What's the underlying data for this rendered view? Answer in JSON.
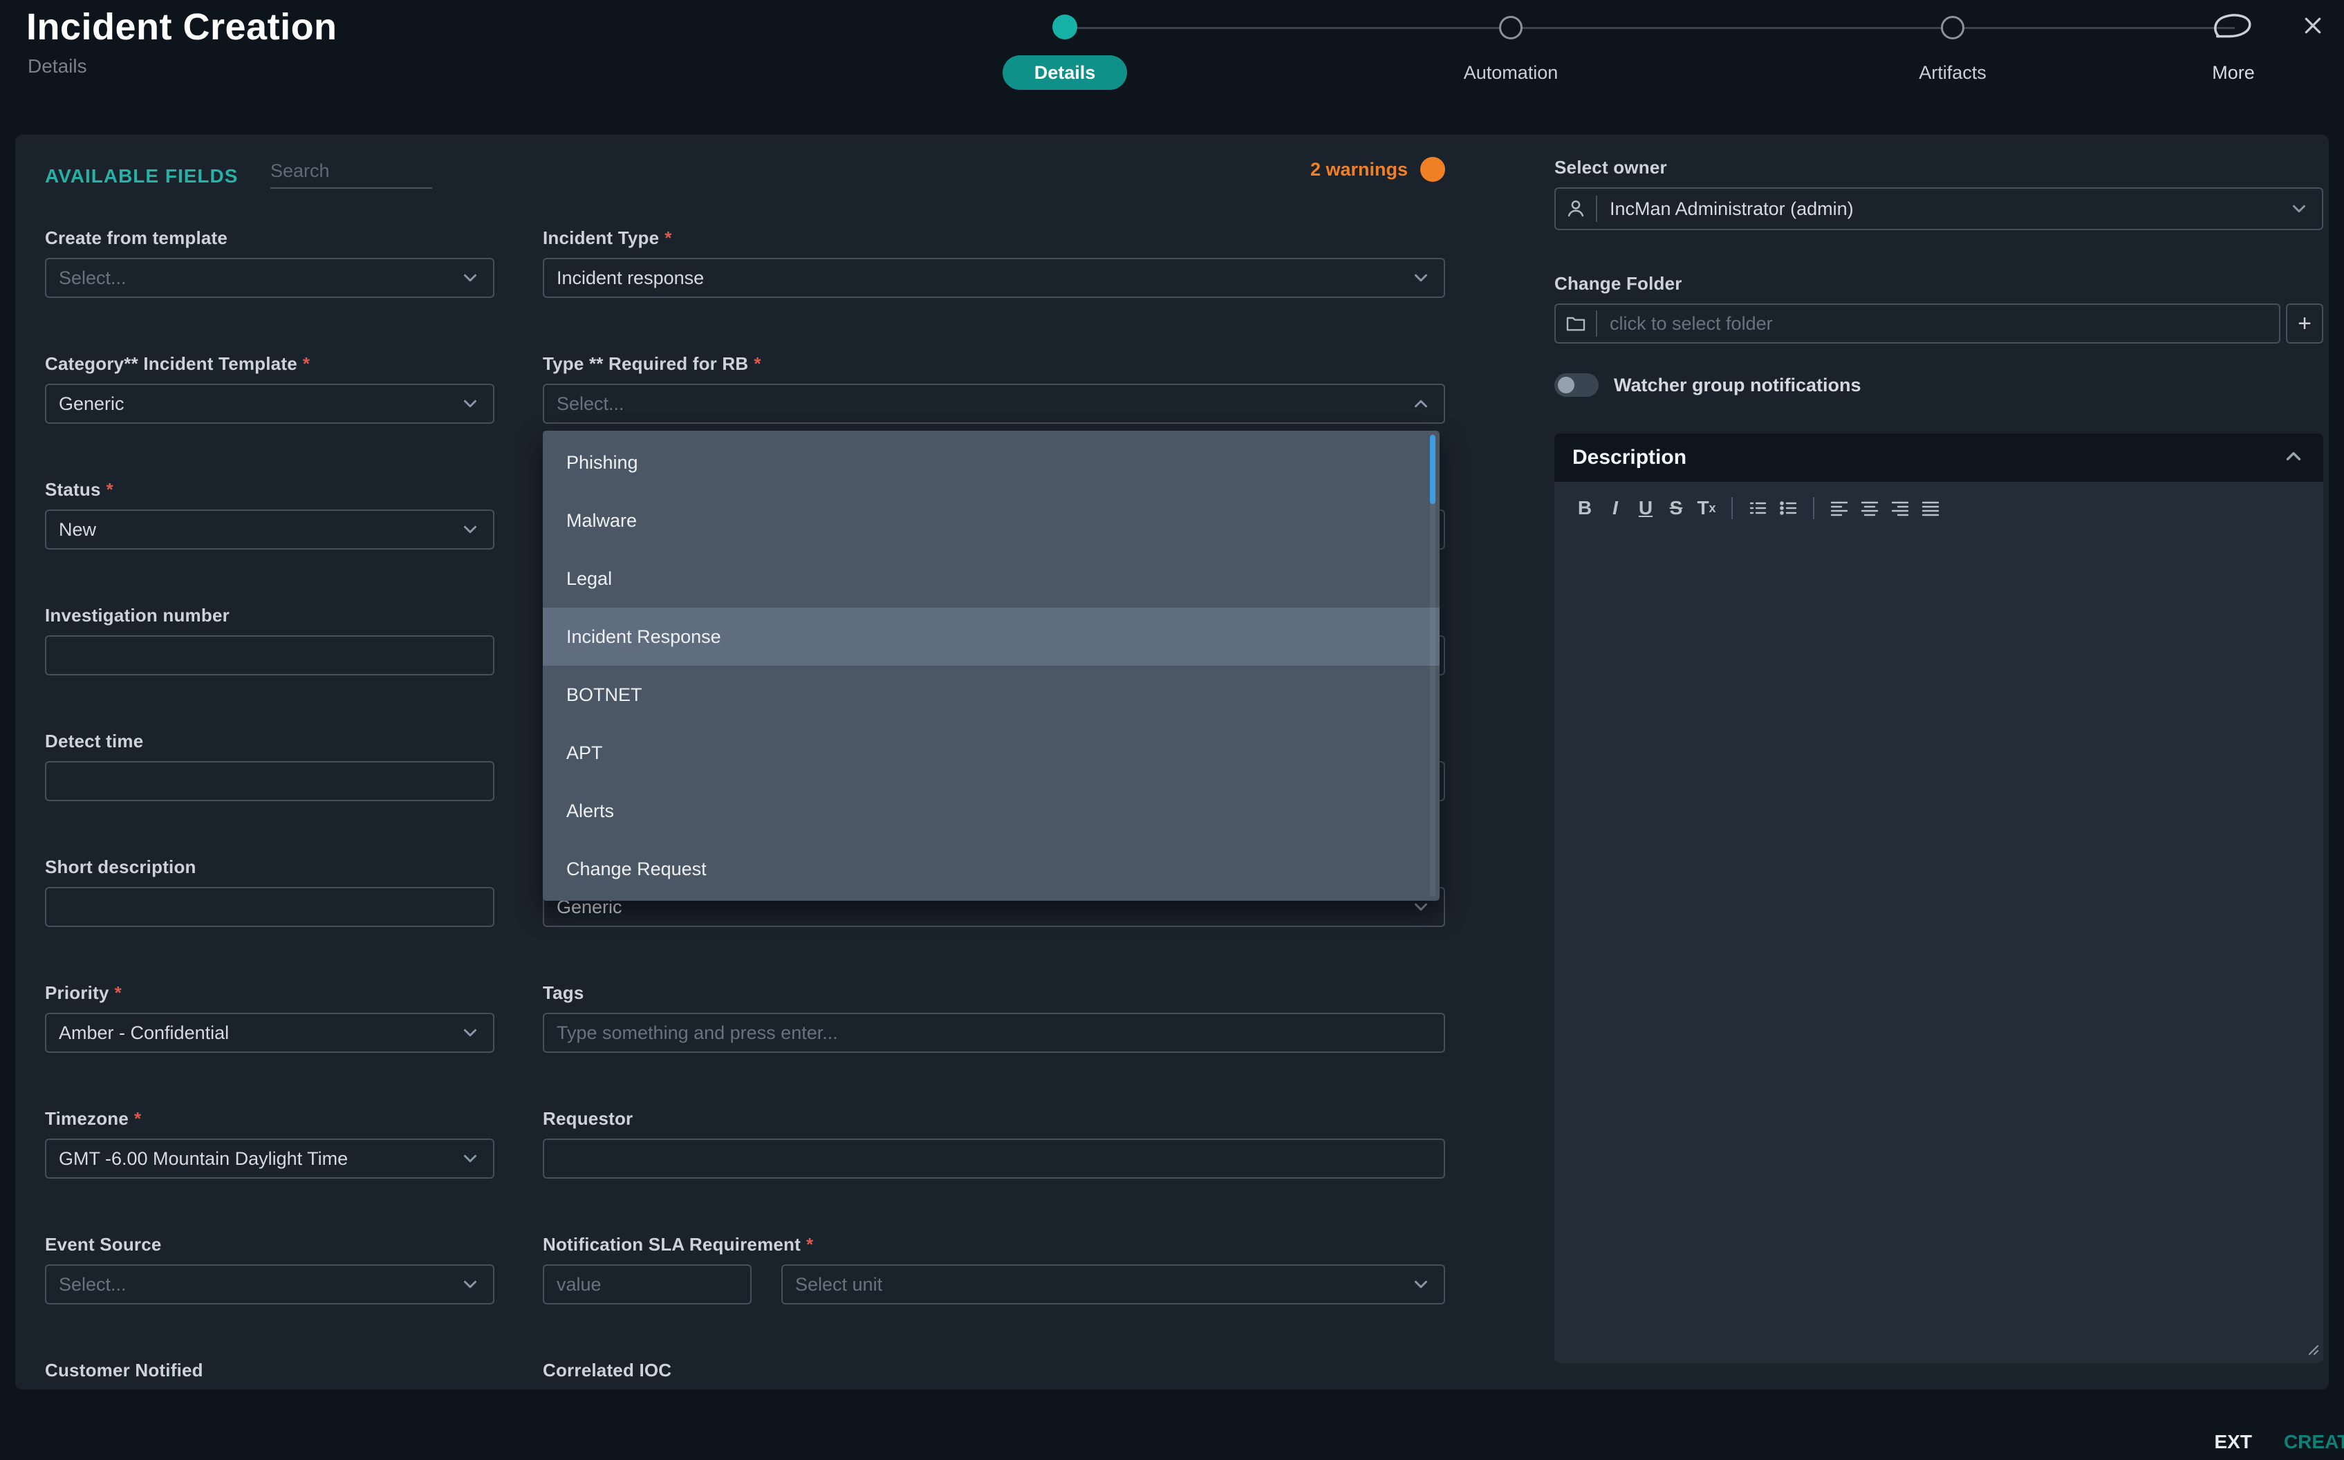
{
  "theme": {
    "accent_teal": "#17b2a7",
    "warning_orange": "#f08025"
  },
  "header": {
    "title": "Incident Creation",
    "subtitle": "Details",
    "steps": [
      {
        "label": "Details"
      },
      {
        "label": "Automation"
      },
      {
        "label": "Artifacts"
      },
      {
        "label": "More"
      }
    ]
  },
  "topbar": {
    "available_fields": "AVAILABLE FIELDS",
    "search_placeholder": "Search",
    "warnings": "2 warnings"
  },
  "left_fields": [
    {
      "label": "Create from template",
      "value": "Select..."
    },
    {
      "label": "Category** Incident Template",
      "required": "*",
      "value": "Generic"
    },
    {
      "label": "Status",
      "required": "*",
      "value": "New"
    },
    {
      "label": "Investigation number"
    },
    {
      "label": "Detect time"
    },
    {
      "label": "Short description"
    },
    {
      "label": "Priority",
      "required": "*",
      "value": "Amber - Confidential"
    },
    {
      "label": "Timezone",
      "required": "*",
      "value": "GMT -6.00 Mountain Daylight Time"
    },
    {
      "label": "Event Source",
      "value": "Select..."
    },
    {
      "label": "Customer Notified"
    }
  ],
  "middle": {
    "incident_type": {
      "label": "Incident Type",
      "required": "*",
      "value": "Incident response"
    },
    "type_rb": {
      "label": "Type ** Required for RB",
      "required": "*",
      "placeholder": "Select..."
    },
    "behind_value": "Generic",
    "tags": {
      "label": "Tags",
      "placeholder": "Type something and press enter..."
    },
    "requestor": {
      "label": "Requestor"
    },
    "sla": {
      "label": "Notification SLA Requirement",
      "required": "*",
      "value_placeholder": "value",
      "unit_placeholder": "Select unit"
    },
    "correlated_ioc_label": "Correlated IOC"
  },
  "type_dropdown": {
    "options": [
      "Phishing",
      "Malware",
      "Legal",
      "Incident Response",
      "BOTNET",
      "APT",
      "Alerts",
      "Change Request"
    ],
    "selected": "Incident Response"
  },
  "right": {
    "owner_label": "Select owner",
    "owner_value": "IncMan Administrator (admin)",
    "folder_label": "Change Folder",
    "folder_placeholder": "click to select folder",
    "plus": "+",
    "watcher_label": "Watcher group notifications",
    "description_title": "Description",
    "editor": {
      "bold": "B",
      "italic": "I",
      "underline": "U",
      "strike": "S",
      "clear_t": "T",
      "clear_x": "x"
    }
  },
  "footer": {
    "ext": "EXT",
    "create": "CREATE"
  }
}
